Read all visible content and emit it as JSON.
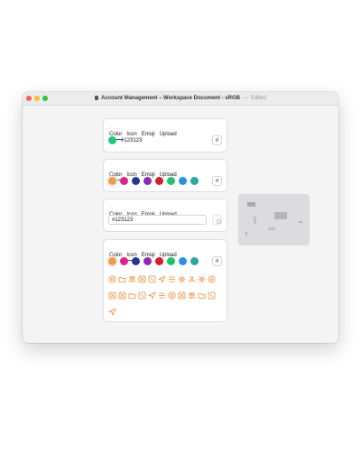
{
  "window": {
    "title": "Account Management – Workspace Document - sRGB",
    "separator": "—",
    "status": "Edited",
    "doc_icon": "document-icon"
  },
  "tabs": [
    "Color",
    "Icon",
    "Emoji",
    "Upload"
  ],
  "card1": {
    "active_tab": "Color",
    "selected_color": "#24c77a",
    "selected_value": "#123123",
    "hash_label": "#"
  },
  "palette": [
    "#f09a4a",
    "#e0218a",
    "#2a3591",
    "#8e2bb0",
    "#d21f2a",
    "#20c26a",
    "#2a90e6",
    "#2aa7a0"
  ],
  "card2": {
    "active_tab": "Color",
    "hash_label": "#"
  },
  "card3": {
    "active_tab": "Color",
    "input_value": "#123123"
  },
  "card4": {
    "active_tab": "Icon",
    "hash_label": "#",
    "icon_color": "#f08c3a",
    "icons": [
      "at-sign-icon",
      "folder-icon",
      "users-icon",
      "grid-icon",
      "edit-icon",
      "send-icon",
      "list-icon",
      "sun-icon",
      "user-group-icon",
      "sun-icon",
      "at-sign-icon",
      "grid-icon",
      "grid-icon",
      "folder-icon",
      "edit-icon",
      "send-icon",
      "list-icon",
      "at-sign-icon",
      "grid-icon",
      "users-icon",
      "folder-icon",
      "edit-icon",
      "send-icon"
    ]
  },
  "thumbnail": {
    "label": "preview-thumbnail"
  }
}
